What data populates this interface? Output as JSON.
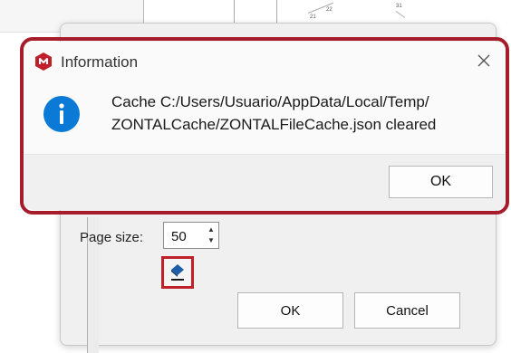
{
  "message_box": {
    "title": "Information",
    "message_line1": "Cache C:/Users/Usuario/AppData/Local/Temp/",
    "message_line2": "ZONTALCache/ZONTALFileCache.json cleared",
    "ok_label": "OK",
    "icons": {
      "app": "zontal-logo-icon",
      "close": "close-icon",
      "info": "info-icon"
    },
    "colors": {
      "highlight": "#a51d2a",
      "info_blue": "#0a7ad6",
      "app_red": "#c0202a"
    }
  },
  "settings_dialog": {
    "page_size_label": "Page size:",
    "page_size_value": "50",
    "clear_cache_icon": "eraser-icon",
    "ok_label": "OK",
    "cancel_label": "Cancel"
  },
  "background": {
    "labels": [
      "21",
      "22",
      "31"
    ]
  }
}
